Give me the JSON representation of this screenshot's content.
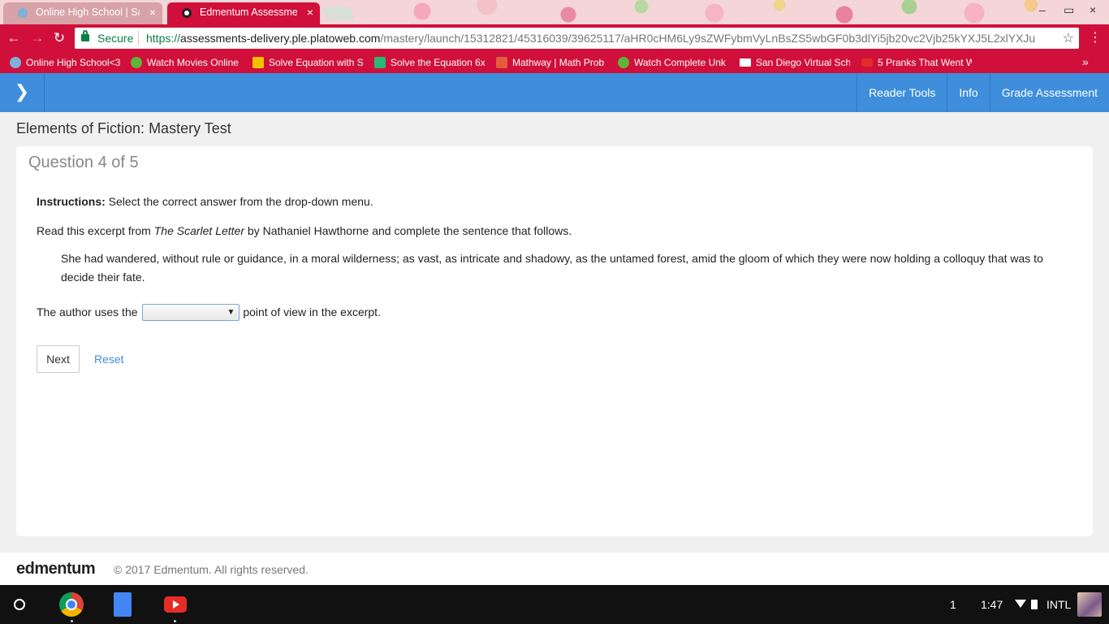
{
  "browser": {
    "tabs": [
      {
        "title": "Online High School | San",
        "active": false
      },
      {
        "title": "Edmentum Assessment",
        "active": true
      }
    ],
    "close_glyph": "×",
    "omnibox": {
      "secure_label": "Secure",
      "url_scheme": "https://",
      "url_host": "assessments-delivery.ple.platoweb.com",
      "url_path": "/mastery/launch/15312821/45316039/39625117/aHR0cHM6Ly9sZWFybmVyLnBsZS5wbGF0b3dlYi5jb20vc2Vjb25kYXJ5L2xlYXJu"
    },
    "bookmarks": [
      {
        "label": "Online High School<3",
        "icon": "globe-icon",
        "color": "#7fb0d8"
      },
      {
        "label": "Watch Movies Online",
        "icon": "play-icon",
        "color": "#5fb336"
      },
      {
        "label": "Solve Equation with S",
        "icon": "q-icon",
        "color": "#f2c200"
      },
      {
        "label": "Solve the Equation 6x",
        "icon": "c-icon",
        "color": "#2bb673"
      },
      {
        "label": "Mathway | Math Prob",
        "icon": "m-icon",
        "color": "#e35d3a"
      },
      {
        "label": "Watch Complete Unk",
        "icon": "play-icon",
        "color": "#5fb336"
      },
      {
        "label": "San Diego Virtual Sch",
        "icon": "mail-icon",
        "color": "#ffffff"
      },
      {
        "label": "5 Pranks That Went W",
        "icon": "youtube-icon",
        "color": "#e52d27"
      }
    ]
  },
  "app": {
    "nav": [
      "Reader Tools",
      "Info",
      "Grade Assessment"
    ],
    "page_title": "Elements of Fiction: Mastery Test",
    "question_counter": "Question 4 of 5",
    "instructions_label": "Instructions:",
    "instructions_text": " Select the correct answer from the drop-down menu.",
    "read_prefix": "Read this excerpt from ",
    "book_title": "The Scarlet Letter",
    "read_suffix": " by Nathaniel Hawthorne and complete the sentence that follows.",
    "excerpt": "She had wandered, without rule or guidance, in a moral wilderness; as vast, as intricate and shadowy, as the untamed forest, amid the gloom of which they were now holding a colloquy that was to decide their fate.",
    "sentence_before": "The author uses the",
    "dropdown_value": "",
    "sentence_after": "point of view in the excerpt.",
    "next_label": "Next",
    "reset_label": "Reset"
  },
  "footer": {
    "logo": "edmentum",
    "copyright": "© 2017 Edmentum. All rights reserved."
  },
  "shelf": {
    "notification_count": "1",
    "time": "1:47",
    "input_method": "INTL"
  },
  "colors": {
    "chrome_red": "#d0103a",
    "app_blue": "#3e8edc",
    "secure_green": "#0b8043"
  }
}
